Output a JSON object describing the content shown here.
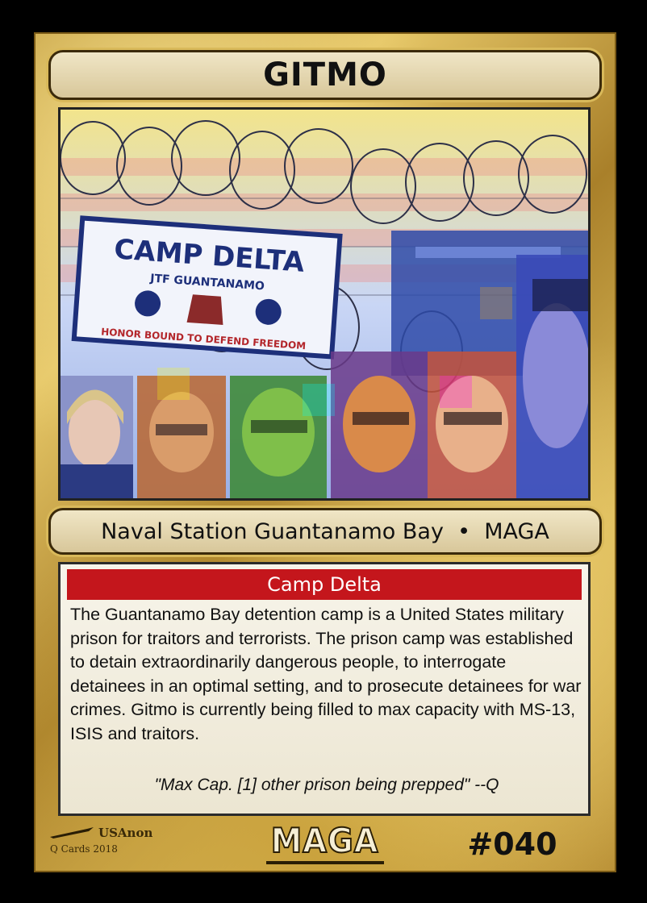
{
  "card": {
    "title": "GITMO",
    "subtitle": "Naval Station Guantanamo Bay  •  MAGA",
    "section_heading": "Camp Delta",
    "body": "The Guantanamo Bay detention camp is a United States military prison for traitors and terrorists. The prison camp was established to detain extraordinarily dangerous people, to interrogate detainees in an optimal setting, and to prosecute detainees for war crimes. Gitmo is currently being filled to max capacity with MS-13, ISIS and traitors.",
    "quote": "\"Max Cap. [1] other prison being prepped\" --Q",
    "footer": {
      "brand": "USAnon",
      "series": "Q Cards 2018",
      "set_logo": "MAGA",
      "number": "#040"
    }
  },
  "artwork": {
    "sign_line1": "CAMP DELTA",
    "sign_line2": "JTF GUANTANAMO",
    "sign_motto": "HONOR BOUND TO DEFEND FREEDOM"
  },
  "colors": {
    "gold": "#d9b95a",
    "banner_red": "#c4161c",
    "text_box": "#f5f1e4"
  }
}
